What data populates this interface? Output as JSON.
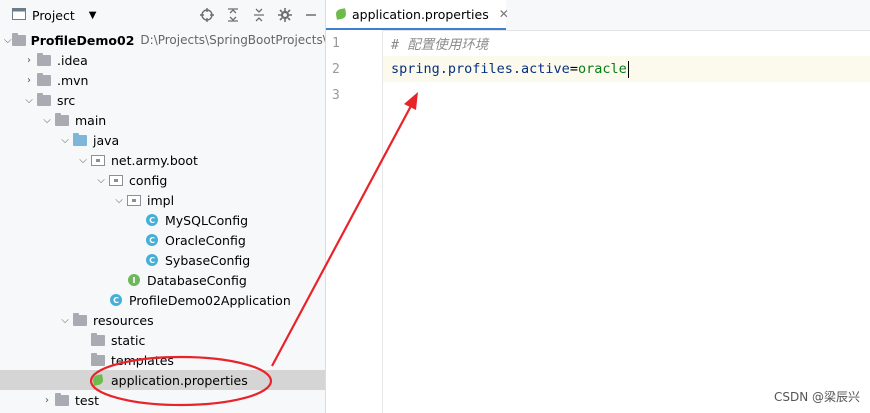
{
  "project_panel": {
    "title": "Project",
    "toolbar_icons": [
      "locate-icon",
      "expand-all-icon",
      "collapse-all-icon",
      "gear-icon",
      "minimize-icon"
    ]
  },
  "tree": [
    {
      "label": "ProfileDemo02",
      "path": "D:\\Projects\\SpringBootProjects\\",
      "icon": "folder",
      "expanded": true,
      "bold": true
    },
    {
      "label": ".idea",
      "icon": "folder",
      "expanded": false
    },
    {
      "label": ".mvn",
      "icon": "folder",
      "expanded": false
    },
    {
      "label": "src",
      "icon": "folder",
      "expanded": true
    },
    {
      "label": "main",
      "icon": "folder",
      "expanded": true
    },
    {
      "label": "java",
      "icon": "source-folder",
      "expanded": true
    },
    {
      "label": "net.army.boot",
      "icon": "package",
      "expanded": true
    },
    {
      "label": "config",
      "icon": "package",
      "expanded": true
    },
    {
      "label": "impl",
      "icon": "package",
      "expanded": true
    },
    {
      "label": "MySQLConfig",
      "icon": "class"
    },
    {
      "label": "OracleConfig",
      "icon": "class"
    },
    {
      "label": "SybaseConfig",
      "icon": "class"
    },
    {
      "label": "DatabaseConfig",
      "icon": "interface"
    },
    {
      "label": "ProfileDemo02Application",
      "icon": "spring-class"
    },
    {
      "label": "resources",
      "icon": "resources-folder",
      "expanded": true
    },
    {
      "label": "static",
      "icon": "folder"
    },
    {
      "label": "templates",
      "icon": "folder"
    },
    {
      "label": "application.properties",
      "icon": "spring-properties",
      "selected": true
    },
    {
      "label": "test",
      "icon": "folder",
      "expanded": false
    }
  ],
  "editor": {
    "tab_label": "application.properties",
    "lines": [
      {
        "number": "1",
        "comment": "# 配置使用环境"
      },
      {
        "number": "2",
        "key": "spring.profiles.active",
        "eq": "=",
        "value": "oracle"
      },
      {
        "number": "3"
      }
    ]
  },
  "watermark": "CSDN @梁辰兴",
  "colors": {
    "annotation_red": "#e8242a",
    "selection": "#d5d5d5",
    "tab_underline": "#3f7fd1"
  }
}
